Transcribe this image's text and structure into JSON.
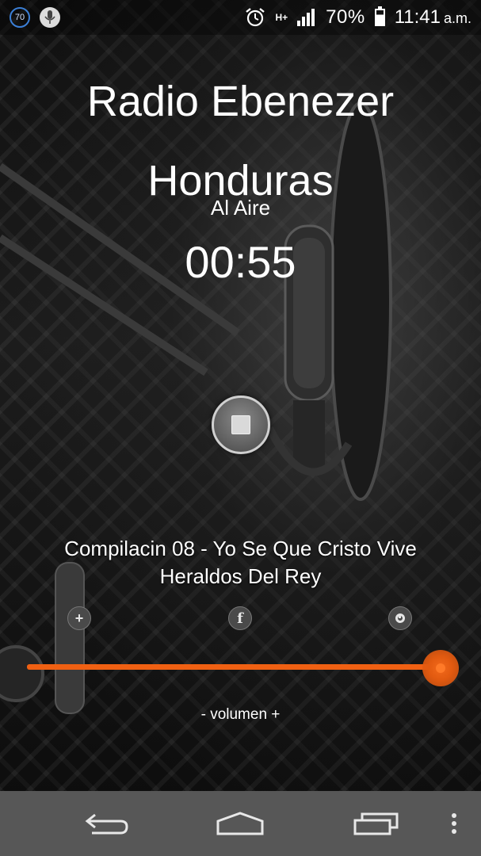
{
  "status_bar": {
    "notification_count": "70",
    "notification_icon": "badge-70-icon",
    "mic_icon": "microphone-icon",
    "alarm_icon": "alarm-clock-icon",
    "network_type": "H+",
    "signal_icon": "signal-bars-icon",
    "battery_level": "70%",
    "battery_icon": "battery-charging-icon",
    "time": "11:41",
    "ampm": "a.m."
  },
  "station": {
    "name_line1": "Radio Ebenezer",
    "name_line2": "Honduras",
    "status": "Al Aire",
    "elapsed": "00:55"
  },
  "player": {
    "stop_icon": "stop-icon",
    "track_title": "Compilacin 08 - Yo Se Que Cristo Vive",
    "track_artist": "Heraldos Del Rey"
  },
  "actions": {
    "add_label": "+",
    "add_icon": "plus-icon",
    "facebook_label": "f",
    "facebook_icon": "facebook-icon",
    "info_icon": "power-icon"
  },
  "volume": {
    "label": "- volumen +",
    "level": 0.96,
    "color": "#f06012"
  },
  "nav_bar": {
    "back_icon": "back-arrow-icon",
    "home_icon": "home-icon",
    "recent_icon": "recent-apps-icon",
    "menu_icon": "overflow-menu-icon",
    "background": "#575757"
  }
}
